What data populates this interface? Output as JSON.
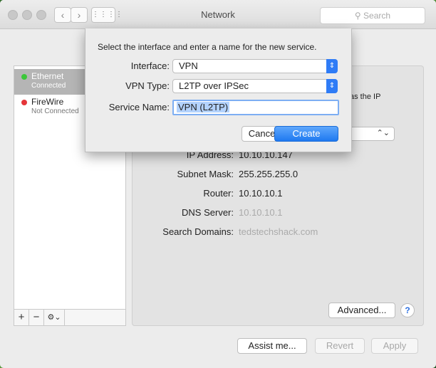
{
  "window": {
    "title": "Network",
    "search_placeholder": "Search"
  },
  "toolbar": {
    "back": "‹",
    "forward": "›",
    "grid": "⋮⋮⋮⋮"
  },
  "services": [
    {
      "name": "Ethernet",
      "status": "Connected",
      "color": "#3cc73a",
      "selected": true
    },
    {
      "name": "FireWire",
      "status": "Not Connected",
      "color": "#e5363a",
      "selected": false
    }
  ],
  "sidebar_tools": {
    "add": "+",
    "remove": "−",
    "gear": "⚙⌄"
  },
  "details": [
    {
      "label": "IP Address:",
      "value": "10.10.10.147",
      "dim": false
    },
    {
      "label": "Subnet Mask:",
      "value": "255.255.255.0",
      "dim": false
    },
    {
      "label": "Router:",
      "value": "10.10.10.1",
      "dim": false
    },
    {
      "label": "DNS Server:",
      "value": "10.10.10.1",
      "dim": true
    },
    {
      "label": "Search Domains:",
      "value": "tedstechshack.com",
      "dim": true
    }
  ],
  "partial_text": "as the IP",
  "buttons": {
    "advanced": "Advanced...",
    "help": "?",
    "assist": "Assist me...",
    "revert": "Revert",
    "apply": "Apply"
  },
  "sheet": {
    "prompt": "Select the interface and enter a name for the new service.",
    "interface_label": "Interface:",
    "interface_value": "VPN",
    "vpn_type_label": "VPN Type:",
    "vpn_type_value": "L2TP over IPSec",
    "service_name_label": "Service Name:",
    "service_name_value": "VPN (L2TP)",
    "cancel": "Cancel",
    "create": "Create"
  },
  "accent_color": "#1e79f0"
}
